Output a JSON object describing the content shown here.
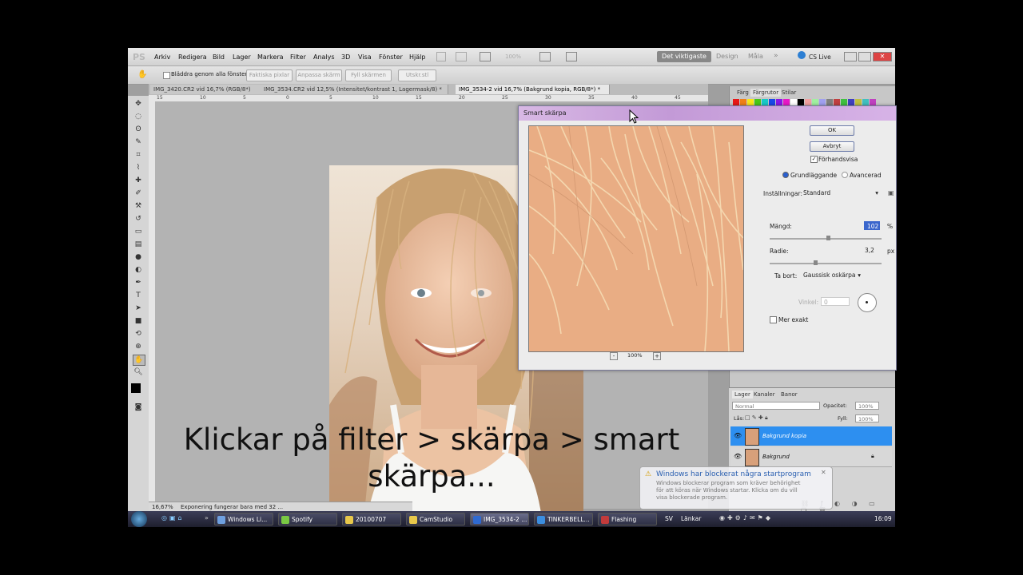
{
  "app": {
    "logo": "PS",
    "menu": [
      "Arkiv",
      "Redigera",
      "Bild",
      "Lager",
      "Markera",
      "Filter",
      "Analys",
      "3D",
      "Visa",
      "Fönster",
      "Hjälp"
    ],
    "zoom_field": "100%",
    "workspaces": [
      "Det viktigaste",
      "Design",
      "Måla"
    ],
    "cs_live": "CS Live"
  },
  "options": {
    "scroll_all": "Bläddra genom alla fönster",
    "buttons": [
      "Faktiska pixlar",
      "Anpassa skärm",
      "Fyll skärmen",
      "Utskr.stl"
    ]
  },
  "tabs": [
    "IMG_3420.CR2 vid 16,7% (RGB/8*)",
    "IMG_3534.CR2 vid 12,5% (Intensitet/kontrast 1, Lagermask/8) *",
    "IMG_3534-2 vid 16,7% (Bakgrund kopia, RGB/8*) *"
  ],
  "ruler_ticks": [
    "15",
    "10",
    "5",
    "0",
    "5",
    "10",
    "15",
    "20",
    "25",
    "30",
    "35",
    "40",
    "45"
  ],
  "status": {
    "zoom": "16,67%",
    "message": "Exponering fungerar bara med 32 ..."
  },
  "panels": {
    "swatch_tabs": [
      "Färg",
      "Färgrutor",
      "Stilar"
    ],
    "swatch_colors": [
      "#e81818",
      "#f08018",
      "#f8e818",
      "#48c818",
      "#18c8c8",
      "#1848e8",
      "#8818e8",
      "#e818c8",
      "#ffffff",
      "#000000",
      "#f0a0a0",
      "#a0f0a0",
      "#a0a0f0",
      "#808080",
      "#c04040",
      "#40c040",
      "#4040c0",
      "#c0c040",
      "#40c0c0",
      "#c040c0"
    ],
    "layer_tabs": [
      "Lager",
      "Kanaler",
      "Banor"
    ],
    "blend_mode": "Normal",
    "opacity_label": "Opacitet:",
    "opacity_value": "100%",
    "lock_label": "Lås:",
    "fill_label": "Fyll:",
    "fill_value": "100%",
    "layers": [
      {
        "name": "Bakgrund kopia",
        "selected": true
      },
      {
        "name": "Bakgrund",
        "selected": false
      }
    ]
  },
  "dialog": {
    "title": "Smart skärpa",
    "ok": "OK",
    "cancel": "Avbryt",
    "preview": "Förhandsvisa",
    "mode_basic": "Grundläggande",
    "mode_advanced": "Avancerad",
    "settings_label": "Inställningar:",
    "settings_value": "Standard",
    "amount_label": "Mängd:",
    "amount_value": "102",
    "amount_unit": "%",
    "amount_fraction": 0.51,
    "radius_label": "Radie:",
    "radius_value": "3,2",
    "radius_unit": "px",
    "radius_fraction": 0.39,
    "remove_label": "Ta bort:",
    "remove_value": "Gaussisk oskärpa",
    "angle_label": "Vinkel:",
    "angle_value": "0",
    "more_accurate": "Mer exakt",
    "zoom": "100%",
    "zoom_out": "-",
    "zoom_in": "+"
  },
  "taskbar": {
    "items": [
      {
        "label": "Windows Li...",
        "color": "#6fa0e0"
      },
      {
        "label": "Spotify",
        "color": "#7ac943"
      },
      {
        "label": "20100707",
        "color": "#e8c84a"
      },
      {
        "label": "CamStudio",
        "color": "#e8c84a"
      },
      {
        "label": "IMG_3534-2 ...",
        "color": "#2f6ad0"
      },
      {
        "label": "TINKERBELL...",
        "color": "#3c8ee0"
      },
      {
        "label": "Flashing",
        "color": "#c23b3b"
      }
    ],
    "lang": "SV",
    "links": "Länkar",
    "clock": "16:09"
  },
  "notification": {
    "title": "Windows har blockerat några startprogram",
    "body": "Windows blockerar program som kräver behörighet för att köras när Windows startar. Klicka om du vill visa blockerade program."
  },
  "caption": "Klickar på filter > skärpa > smart skärpa..."
}
